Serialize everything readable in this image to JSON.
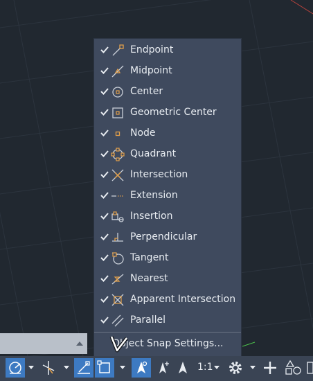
{
  "snap_menu": {
    "items": [
      {
        "label": "Endpoint",
        "checked": true,
        "icon": "endpoint-icon"
      },
      {
        "label": "Midpoint",
        "checked": true,
        "icon": "midpoint-icon"
      },
      {
        "label": "Center",
        "checked": true,
        "icon": "center-icon"
      },
      {
        "label": "Geometric Center",
        "checked": true,
        "icon": "geometric-center-icon"
      },
      {
        "label": "Node",
        "checked": true,
        "icon": "node-icon"
      },
      {
        "label": "Quadrant",
        "checked": true,
        "icon": "quadrant-icon"
      },
      {
        "label": "Intersection",
        "checked": true,
        "icon": "intersection-icon"
      },
      {
        "label": "Extension",
        "checked": true,
        "icon": "extension-icon"
      },
      {
        "label": "Insertion",
        "checked": true,
        "icon": "insertion-icon"
      },
      {
        "label": "Perpendicular",
        "checked": true,
        "icon": "perpendicular-icon"
      },
      {
        "label": "Tangent",
        "checked": true,
        "icon": "tangent-icon"
      },
      {
        "label": "Nearest",
        "checked": true,
        "icon": "nearest-icon"
      },
      {
        "label": "Apparent Intersection",
        "checked": true,
        "icon": "apparent-intersection-icon"
      },
      {
        "label": "Parallel",
        "checked": true,
        "icon": "parallel-icon"
      }
    ],
    "settings_label": "Object Snap Settings..."
  },
  "statusbar": {
    "scale_label": "1:1"
  },
  "colors": {
    "menu_bg": "#3f4a5e",
    "statusbar_bg": "#3a4454",
    "active_button": "#3d7ac2",
    "snap_icon": "#e3a04a",
    "canvas_bg": "#212830"
  }
}
